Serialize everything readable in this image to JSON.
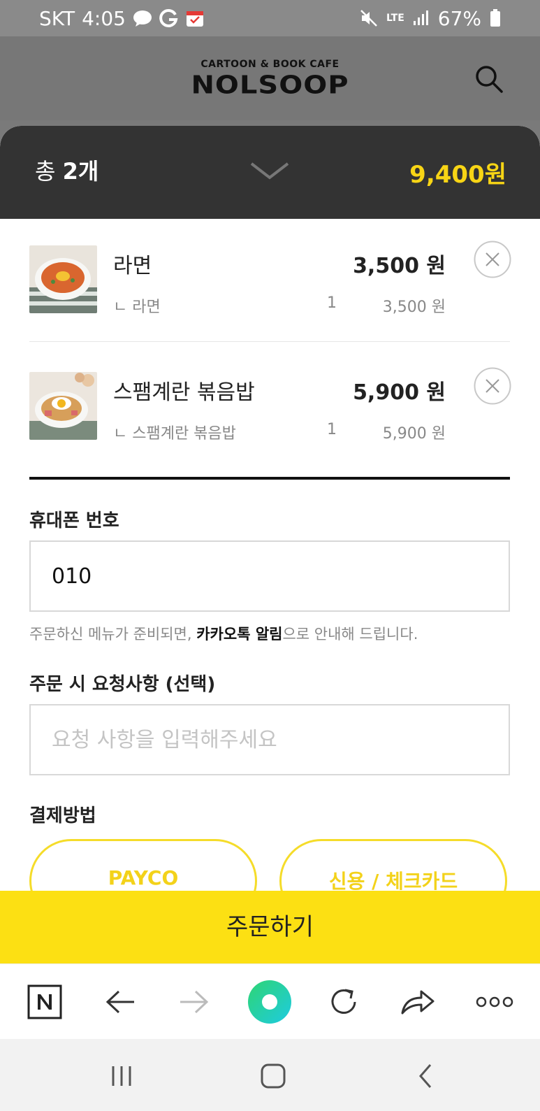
{
  "status_bar": {
    "carrier": "SKT",
    "time": "4:05",
    "network": "LTE",
    "battery": "67%"
  },
  "header": {
    "logo_sub": "CARTOON & BOOK CAFE",
    "logo_main": "NOLSOOP"
  },
  "cart": {
    "total_prefix": "총",
    "total_count": "2개",
    "total_price": "9,400원",
    "items": [
      {
        "name": "라면",
        "price": "3,500 원",
        "option": "ㄴ 라면",
        "qty": "1",
        "subtotal": "3,500 원"
      },
      {
        "name": "스팸계란 볶음밥",
        "price": "5,900 원",
        "option": "ㄴ 스팸계란 볶음밥",
        "qty": "1",
        "subtotal": "5,900 원"
      }
    ]
  },
  "form": {
    "phone_label": "휴대폰 번호",
    "phone_value": "010",
    "notice_pre": "주문하신 메뉴가 준비되면, ",
    "notice_bold": "카카오톡 알림",
    "notice_post": "으로 안내해 드립니다.",
    "request_label": "주문 시 요청사항 (선택)",
    "request_placeholder": "요청 사항을 입력해주세요",
    "payment_label": "결제방법",
    "payment_options": [
      "PAYCO",
      "신용 / 체크카드"
    ]
  },
  "order_button": "주문하기",
  "colors": {
    "accent_yellow": "#fce013",
    "price_yellow": "#f8d515",
    "dark_header": "#333333"
  },
  "browser_toolbar": [
    "naver-n-icon",
    "back-arrow-icon",
    "forward-arrow-icon",
    "home-circle-icon",
    "refresh-icon",
    "share-icon",
    "more-icon"
  ]
}
